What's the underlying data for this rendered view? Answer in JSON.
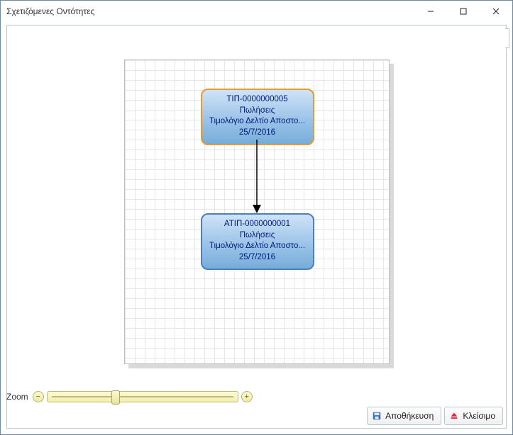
{
  "window": {
    "title": "Σχετιζόμενες Οντότητες"
  },
  "zoom": {
    "label": "Zoom"
  },
  "buttons": {
    "save": "Αποθήκευση",
    "close": "Κλείσιμο"
  },
  "nodes": {
    "a": {
      "code": "ΤΙΠ-0000000005",
      "cat": "Πωλήσεις",
      "type": "Τιμολόγιο Δελτίο Αποστο...",
      "date": "25/7/2016"
    },
    "b": {
      "code": "ΑΤΙΠ-0000000001",
      "cat": "Πωλήσεις",
      "type": "Τιμολόγιο Δελτίο Αποστο...",
      "date": "25/7/2016"
    }
  },
  "chart_data": {
    "type": "diagram",
    "nodes": [
      {
        "id": "a",
        "label": "ΤΙΠ-0000000005",
        "category": "Πωλήσεις",
        "doc_type": "Τιμολόγιο Δελτίο Αποστο...",
        "date": "25/7/2016",
        "selected": true
      },
      {
        "id": "b",
        "label": "ΑΤΙΠ-0000000001",
        "category": "Πωλήσεις",
        "doc_type": "Τιμολόγιο Δελτίο Αποστο...",
        "date": "25/7/2016",
        "selected": false
      }
    ],
    "edges": [
      {
        "from": "a",
        "to": "b",
        "directed": true
      }
    ]
  }
}
